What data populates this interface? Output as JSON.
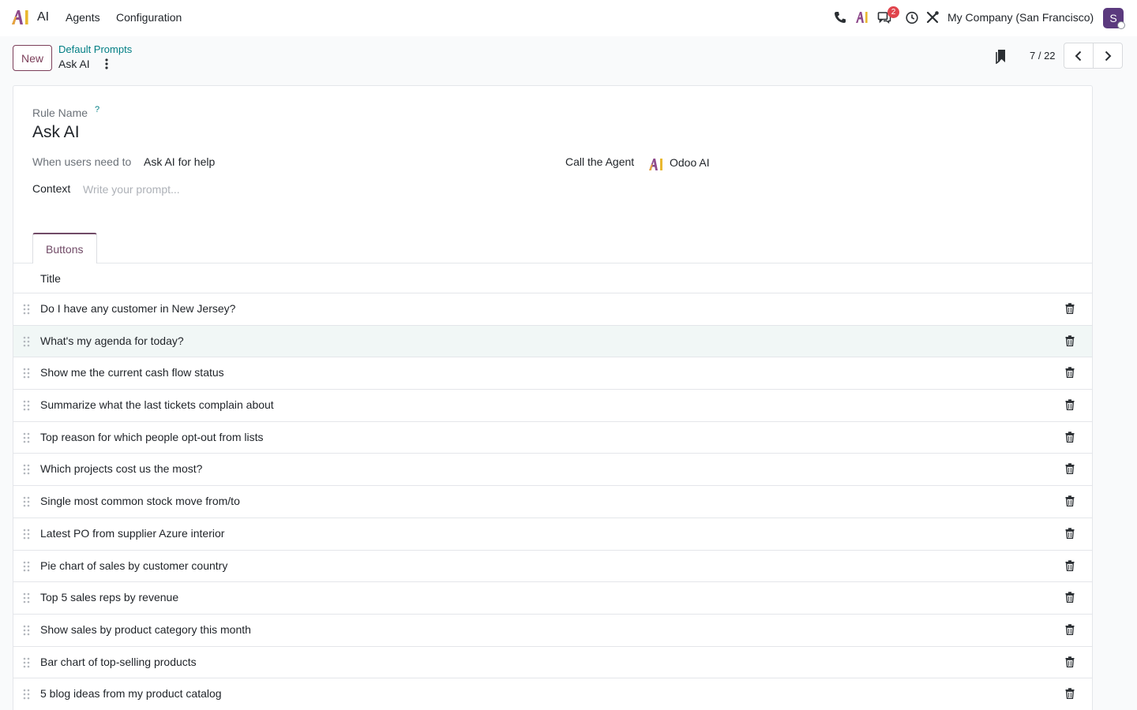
{
  "app": {
    "name": "AI",
    "menu": [
      "Agents",
      "Configuration"
    ]
  },
  "systray": {
    "icons": [
      "phone-icon",
      "ai-logo-icon",
      "messages-icon",
      "clock-icon",
      "tools-icon"
    ],
    "messages_badge": "2",
    "company": "My Company (San Francisco)",
    "avatar_initial": "S"
  },
  "control_panel": {
    "new_button": "New",
    "breadcrumb_parent": "Default Prompts",
    "breadcrumb_current": "Ask AI",
    "pager": "7 / 22"
  },
  "form": {
    "rule_name_label": "Rule Name",
    "help_marker": "?",
    "rule_name": "Ask AI",
    "when_label": "When users need to",
    "when_value": "Ask AI for help",
    "agent_label": "Call the Agent",
    "agent_value": "Odoo AI",
    "context_label": "Context",
    "context_placeholder": "Write your prompt..."
  },
  "tab": {
    "label": "Buttons"
  },
  "list": {
    "column_title": "Title",
    "rows": [
      "Do I have any customer in New Jersey?",
      "What's my agenda for today?",
      "Show me the current cash flow status",
      "Summarize what the last tickets complain about",
      "Top reason for which people opt-out from lists",
      "Which projects cost us the most?",
      "Single most common stock move from/to",
      "Latest PO from supplier Azure interior",
      "Pie chart of sales by customer country",
      "Top 5 sales reps by revenue",
      "Show sales by product category this month",
      "Bar chart of top-selling products",
      "5 blog ideas from my product catalog"
    ]
  },
  "colors": {
    "brand": "#714b67",
    "link": "#017e84",
    "row_highlight": "#f1f7f6",
    "badge": "#e0444c"
  }
}
